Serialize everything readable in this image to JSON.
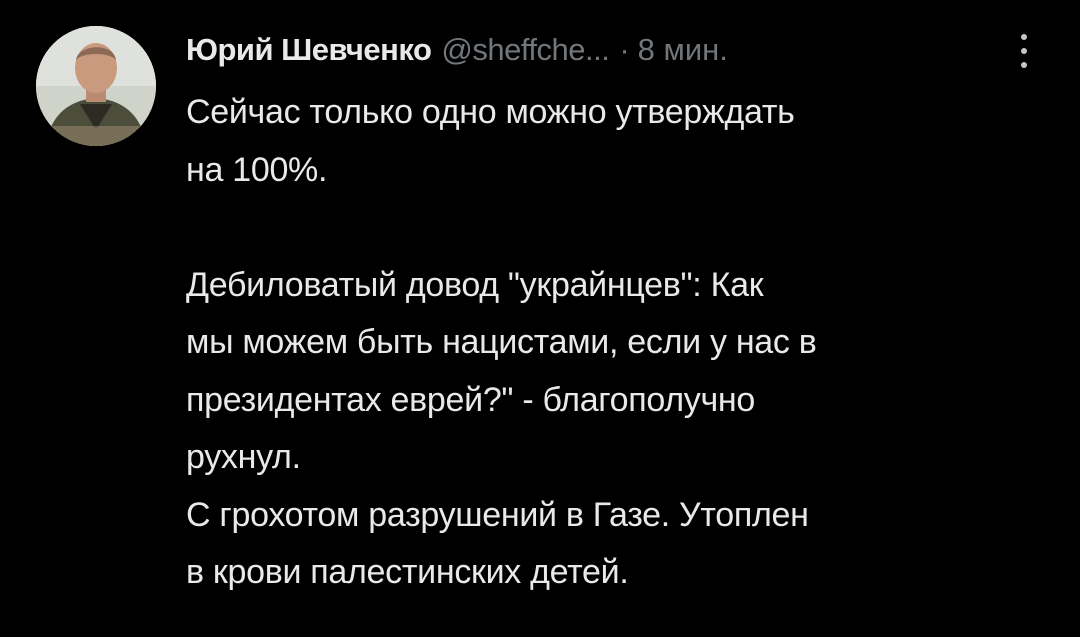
{
  "tweet": {
    "author": {
      "display_name": "Юрий Шевченко",
      "handle": "@sheffche...",
      "avatar_icon": "user-avatar-photo"
    },
    "separator": "·",
    "timestamp": "8 мин.",
    "more_icon": "vertical-dots-icon",
    "text": {
      "paragraph1": "Сейчас только одно можно утверждать\nна 100%.",
      "paragraph2": "Дебиловатый довод \"украйнцев\": Как\nмы можем быть нацистами, если у нас в\nпрезидентах еврей?\" - благополучно\nрухнул.\nС грохотом разрушений в Газе. Утоплен\nв крови палестинских детей."
    }
  },
  "colors": {
    "background": "#000000",
    "primary_text": "#e7e9ea",
    "secondary_text": "#71767b"
  }
}
